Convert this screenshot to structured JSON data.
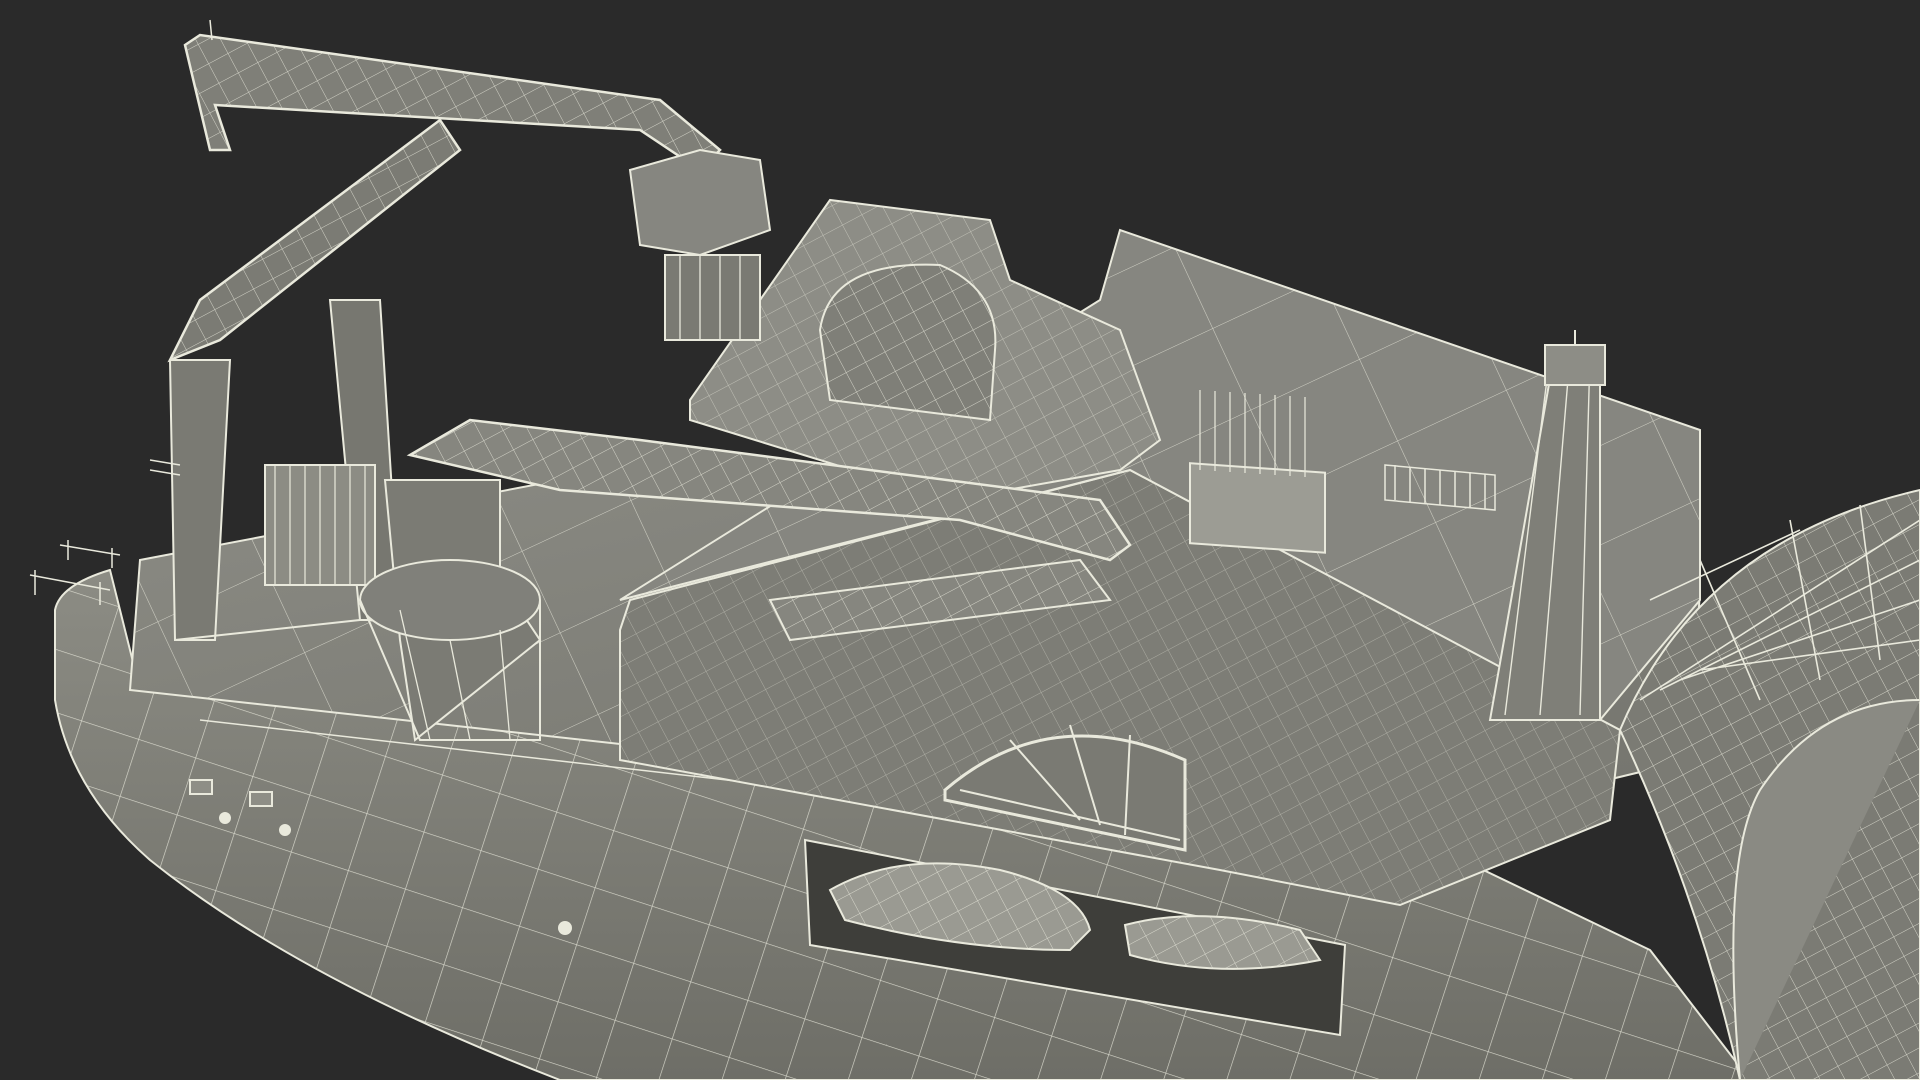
{
  "scene": {
    "subject": "ship-wireframe-render",
    "colors": {
      "background": "#2a2a2a",
      "hull": "#7b7b72",
      "hull_shadow": "#5f5f58",
      "deck": "#808079",
      "structure": "#8a8a82",
      "wire": "#e9e9dc",
      "wire_dim": "#bdbdb0"
    }
  }
}
